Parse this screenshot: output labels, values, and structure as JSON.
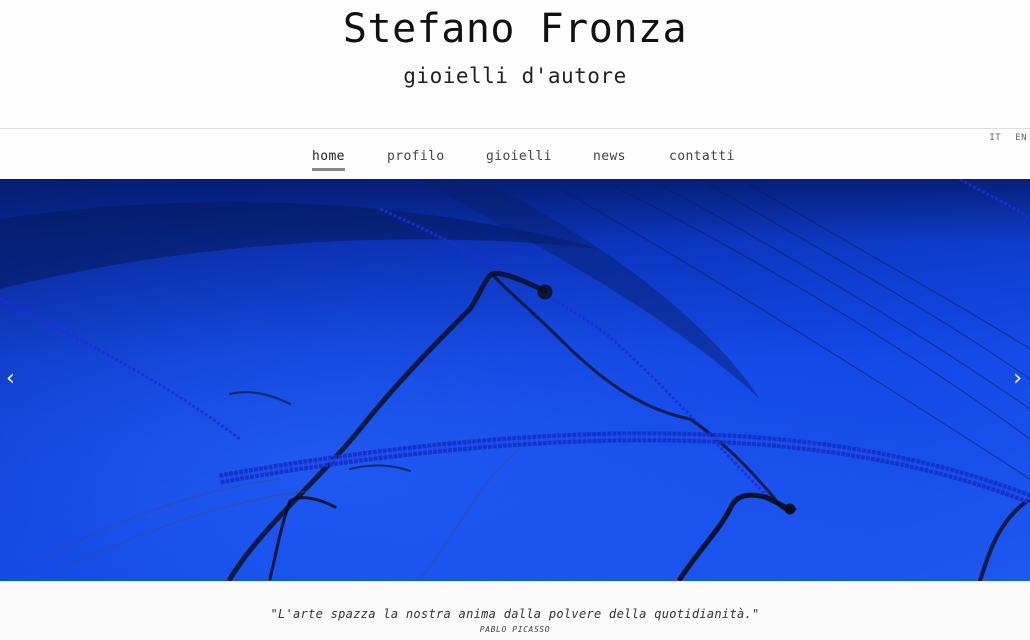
{
  "header": {
    "title": "Stefano Fronza",
    "subtitle": "gioielli d'autore"
  },
  "language": {
    "it": "IT",
    "en": "EN"
  },
  "nav": {
    "items": [
      {
        "label": "home",
        "active": true
      },
      {
        "label": "profilo"
      },
      {
        "label": "gioielli"
      },
      {
        "label": "news"
      },
      {
        "label": "contatti"
      }
    ]
  },
  "slider": {
    "prev_icon": "chevron-left",
    "next_icon": "chevron-right",
    "prev_glyph": "‹",
    "next_glyph": "›",
    "image_colors": {
      "base": "#0d3bd0",
      "dark": "#031040",
      "ink": "#1a1a1a"
    }
  },
  "quote": {
    "text": "\"L'arte spazza la nostra anima dalla polvere della quotidianità.\"",
    "author": "PABLO PICASSO"
  }
}
